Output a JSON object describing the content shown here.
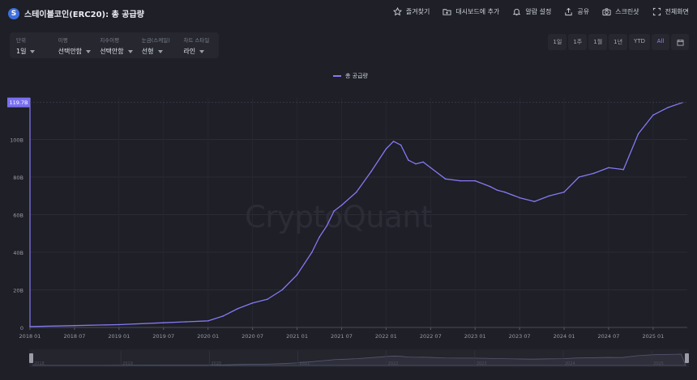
{
  "header": {
    "coin_symbol": "S",
    "title": "스테이블코인(ERC20): 총 공급량",
    "actions": [
      {
        "label": "즐겨찾기",
        "icon": "star-icon"
      },
      {
        "label": "대시보드에 추가",
        "icon": "folder-plus-icon"
      },
      {
        "label": "알람 설정",
        "icon": "bell-icon"
      },
      {
        "label": "공유",
        "icon": "share-icon"
      },
      {
        "label": "스크린샷",
        "icon": "camera-icon"
      },
      {
        "label": "전체화면",
        "icon": "fullscreen-icon"
      }
    ]
  },
  "controls": [
    {
      "label": "단위",
      "value": "1일"
    },
    {
      "label": "이평",
      "value": "선택안함"
    },
    {
      "label": "지수이평",
      "value": "선택안함"
    },
    {
      "label": "눈금(스케일)",
      "value": "선형"
    },
    {
      "label": "차트 스타일",
      "value": "라인"
    }
  ],
  "ranges": {
    "items": [
      "1일",
      "1주",
      "1월",
      "1년",
      "YTD",
      "All"
    ],
    "active": "All",
    "calendar_icon": "calendar-icon"
  },
  "watermark": "CryptoQuant",
  "chart_data": {
    "type": "line",
    "legend": "top-center",
    "grid": true,
    "x_ticks": [
      "2018 01",
      "2018 07",
      "2019 01",
      "2019 07",
      "2020 01",
      "2020 07",
      "2021 01",
      "2021 07",
      "2022 01",
      "2022 07",
      "2023 01",
      "2023 07",
      "2024 01",
      "2024 07",
      "2025 01"
    ],
    "y_ticks": [
      "0",
      "20B",
      "40B",
      "60B",
      "80B",
      "100B"
    ],
    "ylim": [
      0,
      120
    ],
    "y_unit": "B",
    "last_value_label": "119.7B",
    "navigator_ticks": [
      "2018",
      "2019",
      "2020",
      "2021",
      "2022",
      "2023",
      "2024",
      "2025"
    ],
    "colors": {
      "line": "#8579f2",
      "badge": "#7a6ff0"
    },
    "series": [
      {
        "name": "총 공급량",
        "x": [
          "2018-01",
          "2018-07",
          "2019-01",
          "2019-07",
          "2019-10",
          "2020-01",
          "2020-03",
          "2020-05",
          "2020-07",
          "2020-09",
          "2020-11",
          "2021-01",
          "2021-02",
          "2021-03",
          "2021-04",
          "2021-05",
          "2021-06",
          "2021-07",
          "2021-09",
          "2021-11",
          "2022-01",
          "2022-02",
          "2022-03",
          "2022-04",
          "2022-05",
          "2022-06",
          "2022-07",
          "2022-09",
          "2022-11",
          "2023-01",
          "2023-03",
          "2023-04",
          "2023-05",
          "2023-07",
          "2023-09",
          "2023-11",
          "2024-01",
          "2024-03",
          "2024-05",
          "2024-07",
          "2024-09",
          "2024-11",
          "2024-12",
          "2025-01",
          "2025-03",
          "2025-05"
        ],
        "values": [
          0.5,
          1,
          1.5,
          2.5,
          3,
          3.5,
          6,
          10,
          13,
          15,
          20,
          28,
          34,
          40,
          48,
          54,
          62,
          65,
          72,
          83,
          95,
          99,
          97,
          89,
          87,
          88,
          85,
          79,
          78,
          78,
          75,
          73,
          72,
          69,
          67,
          70,
          72,
          80,
          82,
          85,
          84,
          103,
          108,
          113,
          117,
          119.7
        ]
      }
    ]
  }
}
